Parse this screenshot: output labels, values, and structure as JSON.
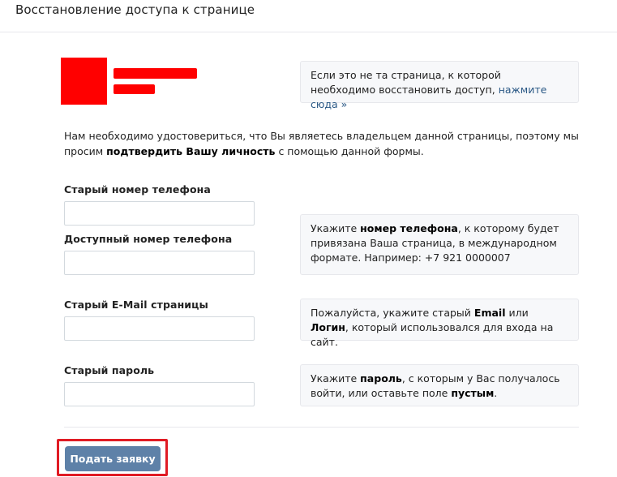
{
  "header": {
    "title": "Восстановление доступа к странице"
  },
  "profile": {
    "hint_prefix": "Если это не та страница, к которой необходимо восстановить доступ,",
    "hint_link": "нажмите сюда »"
  },
  "intro": {
    "part1": "Нам необходимо удостовериться, что Вы являетесь владельцем данной страницы, поэтому мы просим",
    "bold": "подтвердить Вашу личность",
    "part2": "с помощью данной формы."
  },
  "fields": {
    "old_phone": {
      "label": "Старый номер телефона",
      "value": ""
    },
    "new_phone": {
      "label": "Доступный номер телефона",
      "value": ""
    },
    "old_email": {
      "label": "Старый E-Mail страницы",
      "value": ""
    },
    "old_password": {
      "label": "Старый пароль",
      "value": ""
    }
  },
  "hints": {
    "phone": {
      "a": "Укажите",
      "b": "номер телефона",
      "c": ", к которому будет привязана Ваша страница, в международном формате. Например: +7 921 0000007"
    },
    "email": {
      "a": "Пожалуйста, укажите старый",
      "b": "Email",
      "c": "или",
      "d": "Логин",
      "e": ", который использовался для входа на сайт."
    },
    "password": {
      "a": "Укажите",
      "b": "пароль",
      "c": ", с которым у Вас получалось войти, или оставьте поле",
      "d": "пустым",
      "e": "."
    }
  },
  "actions": {
    "submit_label": "Подать заявку"
  },
  "colors": {
    "accent_button": "#5e81a8",
    "link": "#2a5885",
    "highlight": "#e01b24",
    "redaction": "#ff0000"
  }
}
